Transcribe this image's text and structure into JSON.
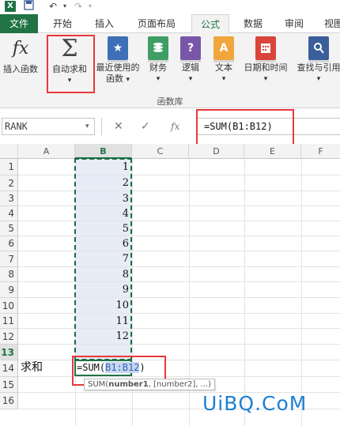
{
  "window": {
    "app_icon": "X",
    "undo": "↶",
    "redo": "↷"
  },
  "tabs": [
    {
      "label": "文件"
    },
    {
      "label": "开始"
    },
    {
      "label": "插入"
    },
    {
      "label": "页面布局"
    },
    {
      "label": "公式"
    },
    {
      "label": "数据"
    },
    {
      "label": "审阅"
    },
    {
      "label": "视图"
    }
  ],
  "ribbon": {
    "insert_function": {
      "icon_text": "fx",
      "label": "插入函数"
    },
    "autosum": {
      "icon_text": "Σ",
      "label": "自动求和",
      "dropdown": "▾"
    },
    "recent": {
      "label1": "最近使用的",
      "label2": "函数",
      "dropdown": "▾"
    },
    "financial": {
      "label": "财务",
      "dropdown": "▾"
    },
    "logical": {
      "label": "逻辑",
      "dropdown": "▾"
    },
    "text": {
      "label": "文本",
      "dropdown": "▾"
    },
    "datetime": {
      "label": "日期和时间",
      "dropdown": "▾"
    },
    "lookup": {
      "label": "查找与引用",
      "dropdown": "▾"
    },
    "group_label": "函数库",
    "colors": {
      "blue": "#3d6fb6",
      "green": "#3f9e63",
      "purple": "#7a56a8",
      "orange": "#f0a63c",
      "red": "#d9453a",
      "navy": "#3a5f9a"
    }
  },
  "formula_bar": {
    "name_box": "RANK",
    "cancel": "✕",
    "enter": "✓",
    "fx": "fx",
    "formula": "=SUM(B1:B12)"
  },
  "grid": {
    "columns": [
      "A",
      "B",
      "C",
      "D",
      "E",
      "F"
    ],
    "rows": [
      "1",
      "2",
      "3",
      "4",
      "5",
      "6",
      "7",
      "8",
      "9",
      "10",
      "11",
      "12",
      "13",
      "14",
      "15",
      "16"
    ],
    "b_values": [
      "1",
      "2",
      "3",
      "4",
      "5",
      "6",
      "7",
      "8",
      "9",
      "10",
      "11",
      "12"
    ],
    "a13_label": "求和",
    "edit_prefix": "=SUM(",
    "edit_ref": "B1:B12",
    "edit_suffix": ")",
    "tooltip_fn": "SUM(",
    "tooltip_bold": "number1",
    "tooltip_rest": ", [number2], ...)"
  },
  "watermark": "UiBQ.CoM"
}
